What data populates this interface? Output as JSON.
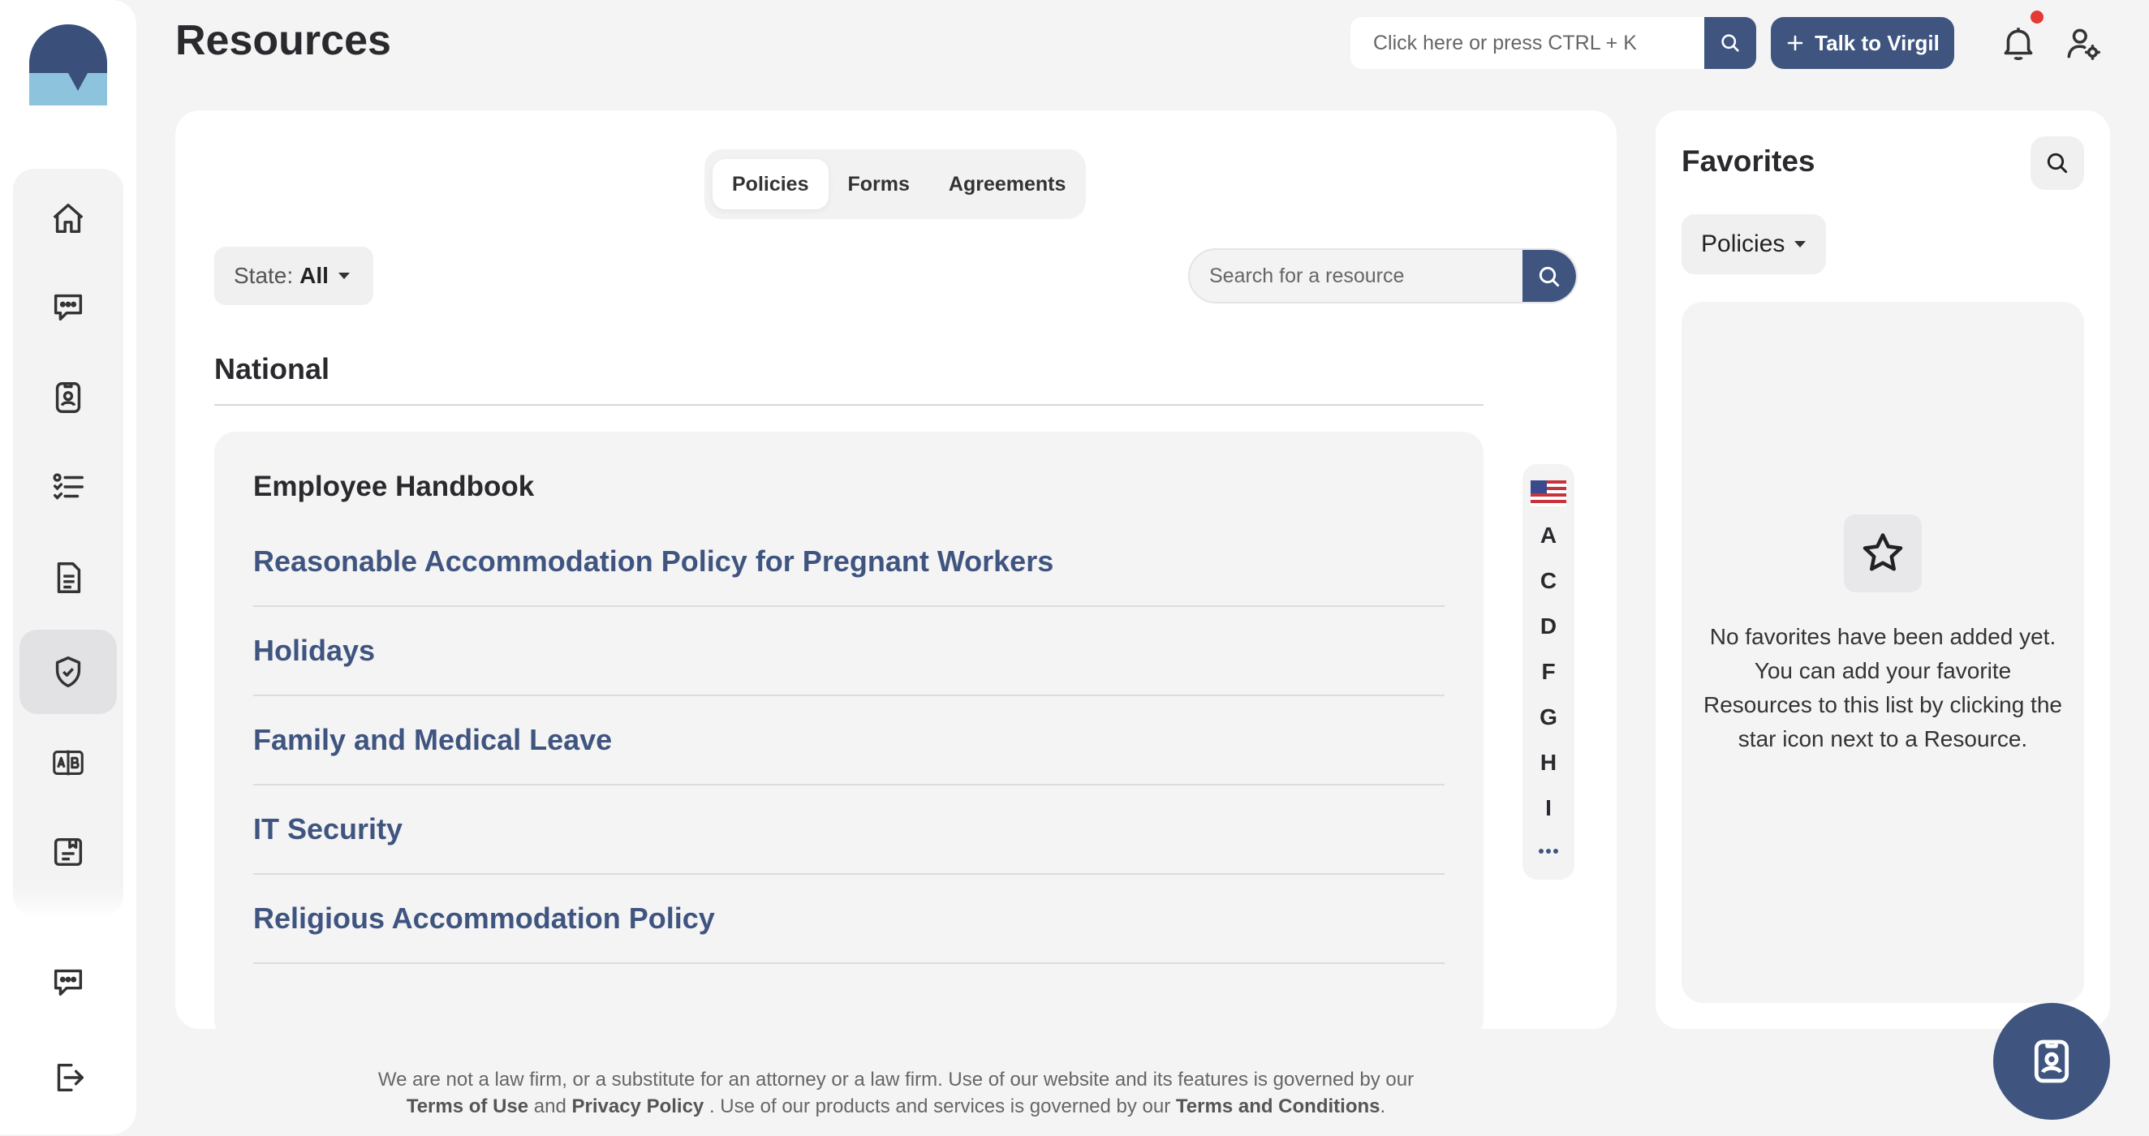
{
  "header": {
    "title": "Resources",
    "search_placeholder": "Click here or press CTRL + K",
    "talk_button": "Talk to Virgil"
  },
  "tabs": [
    {
      "label": "Policies",
      "active": true
    },
    {
      "label": "Forms",
      "active": false
    },
    {
      "label": "Agreements",
      "active": false
    }
  ],
  "filters": {
    "state_label": "State:",
    "state_value": "All",
    "search_placeholder": "Search for a resource"
  },
  "section": {
    "title": "National",
    "list_heading": "Employee Handbook",
    "items": [
      "Reasonable Accommodation Policy for Pregnant Workers",
      "Holidays",
      "Family and Medical Leave",
      "IT Security",
      "Religious Accommodation Policy"
    ]
  },
  "alphabet": [
    "A",
    "C",
    "D",
    "F",
    "G",
    "H",
    "I"
  ],
  "favorites": {
    "title": "Favorites",
    "filter_value": "Policies",
    "empty_line1": "No favorites have been added yet.",
    "empty_line2": "You can add your favorite Resources to this list by clicking the star icon next to a Resource."
  },
  "footer": {
    "text1": "We are not a law firm, or a substitute for an attorney or a law firm. Use of our website and its features is governed by our",
    "terms_of_use": "Terms of Use",
    "and": "and",
    "privacy_policy": "Privacy Policy",
    "text2": ". Use of our products and services is governed by our",
    "terms_conditions": "Terms and Conditions",
    "period": "."
  },
  "colors": {
    "accent": "#3f5580",
    "logo_dark": "#3a4f79",
    "logo_light": "#8ec3de",
    "notification": "#e53935"
  },
  "icons": {
    "nav": [
      "home-icon",
      "chat-icon",
      "badge-icon",
      "checklist-icon",
      "document-icon",
      "shield-check-icon",
      "translate-icon",
      "bookmark-doc-icon"
    ],
    "nav_bottom": [
      "chat-icon",
      "logout-icon"
    ]
  }
}
